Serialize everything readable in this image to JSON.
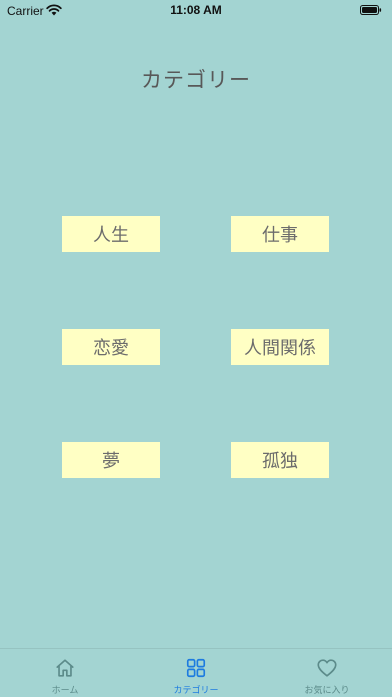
{
  "status_bar": {
    "carrier": "Carrier",
    "time": "11:08 AM"
  },
  "page": {
    "title": "カテゴリー"
  },
  "categories": [
    {
      "label": "人生"
    },
    {
      "label": "仕事"
    },
    {
      "label": "恋愛"
    },
    {
      "label": "人間関係"
    },
    {
      "label": "夢"
    },
    {
      "label": "孤独"
    }
  ],
  "tab_bar": {
    "items": [
      {
        "label": "ホーム",
        "icon": "home-icon",
        "active": false
      },
      {
        "label": "カテゴリー",
        "icon": "grid-icon",
        "active": true
      },
      {
        "label": "お気に入り",
        "icon": "heart-icon",
        "active": false
      }
    ]
  },
  "colors": {
    "background": "#a3d4d2",
    "button": "#ffffc4",
    "active_tab": "#1d7be0",
    "inactive_tab": "#5c8b8a"
  }
}
